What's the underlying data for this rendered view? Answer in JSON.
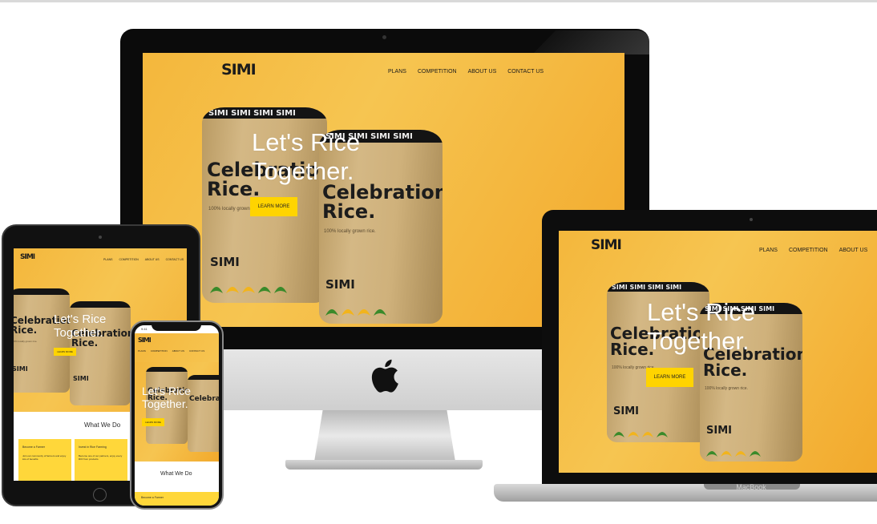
{
  "brand": {
    "logo_text": "SIMI"
  },
  "nav": {
    "plans": "PLANS",
    "competition": "COMPETITION",
    "about_us": "ABOUT US",
    "contact_us": "CONTACT US"
  },
  "hero": {
    "title_line1": "Let's Rice",
    "title_line2": "Together.",
    "button_label": "LEARN MORE"
  },
  "bag": {
    "band_text": "SIMI SIMI SIMI SIMI",
    "name_line1": "Celebration",
    "name_line2": "Rice.",
    "tagline": "100% locally grown rice.",
    "logo_text": "SIMI"
  },
  "what_we_do": {
    "heading": "What We Do",
    "card1_title": "Become a Farmer",
    "card1_text": "Join our community of farmers and enjoy lots of benefits.",
    "card2_title": "Invest in Rice Farming",
    "card2_text": "Become one of our partners, enjoy every ROI from products."
  },
  "phone": {
    "status_time": "9:41"
  },
  "laptop": {
    "label": "MacBook"
  },
  "colors": {
    "accent_yellow": "#ffd400",
    "hero_orange": "#f4b73c",
    "bag_kraft": "#cfb17b",
    "leaf_green": "#3a8a2a",
    "leaf_yellow": "#f2b41c"
  }
}
